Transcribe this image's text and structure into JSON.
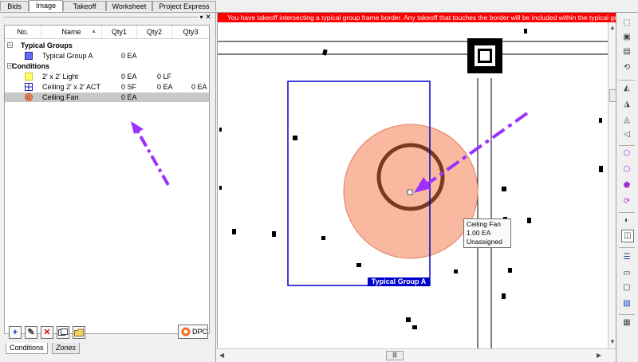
{
  "tabs": [
    {
      "label": "Bids",
      "active": false
    },
    {
      "label": "Image",
      "active": true
    },
    {
      "label": "Takeoff",
      "active": false
    },
    {
      "label": "Worksheet",
      "active": false
    },
    {
      "label": "Project Express",
      "active": false
    }
  ],
  "panel": {
    "close_glyph": "✕",
    "dropdown_glyph": "▾"
  },
  "tree": {
    "columns": {
      "no": "No.",
      "name": "Name",
      "sort_glyph": "▲",
      "qty1": "Qty1",
      "qty2": "Qty2",
      "qty3": "Qty3"
    },
    "groups": [
      {
        "label": "Typical Groups",
        "expander": "−"
      },
      {
        "label": "Conditions",
        "expander": "−"
      }
    ],
    "rows": [
      {
        "name": "Typical Group A",
        "qty1": "0 EA",
        "qty2": "",
        "qty3": "",
        "icon": "typical-group-icon",
        "color": "#6a6aff"
      },
      {
        "name": "2' x 2' Light",
        "qty1": "0 EA",
        "qty2": "0 LF",
        "qty3": "",
        "icon": "light-icon",
        "color": "#ffff66"
      },
      {
        "name": "Ceiling 2' x 2' ACT",
        "qty1": "0 SF",
        "qty2": "0 EA",
        "qty3": "0 EA",
        "icon": "grid-icon",
        "color": "#2020c0"
      },
      {
        "name": "Ceiling Fan",
        "qty1": "0 EA",
        "qty2": "",
        "qty3": "",
        "icon": "fan-icon",
        "color": "#ff9966"
      }
    ]
  },
  "toolbar": {
    "add_glyph": "+",
    "edit_glyph": "✎",
    "delete_glyph": "✕",
    "dpc_label": "DPC"
  },
  "bottom_tabs": [
    {
      "label": "Conditions",
      "active": true
    },
    {
      "label": "Zones",
      "active": false
    }
  ],
  "canvas": {
    "warning": "You have takeoff intersecting a typical group frame border.  Any takeoff that touches the border will be included within the typical group.",
    "group_label": "Typical Group A",
    "tooltip": {
      "line1": "Ceiling Fan",
      "line2": "1.00 EA",
      "line3": "Unassigned"
    },
    "fan_fill": "#f9b9a0",
    "fan_ring": "#7a3a22",
    "frame_color": "#0000cc",
    "arrow_color": "#9b30ff",
    "warn_color": "#ff0000"
  },
  "scroll": {
    "thumb_glyph": "|||",
    "left": "◀",
    "right": "▶",
    "up": "▲",
    "down": "▼"
  },
  "right_tools": [
    "select-icon",
    "window-icon",
    "page-icon",
    "rotate-icon",
    "measure-icon",
    "area-icon",
    "linear-icon",
    "count-icon",
    "poly-icon",
    "shape-icon",
    "cut-icon",
    "rotate-shape-icon",
    "contrast-icon",
    "split-icon",
    "list-icon",
    "comment-icon",
    "page-number-icon",
    "notes-icon"
  ]
}
